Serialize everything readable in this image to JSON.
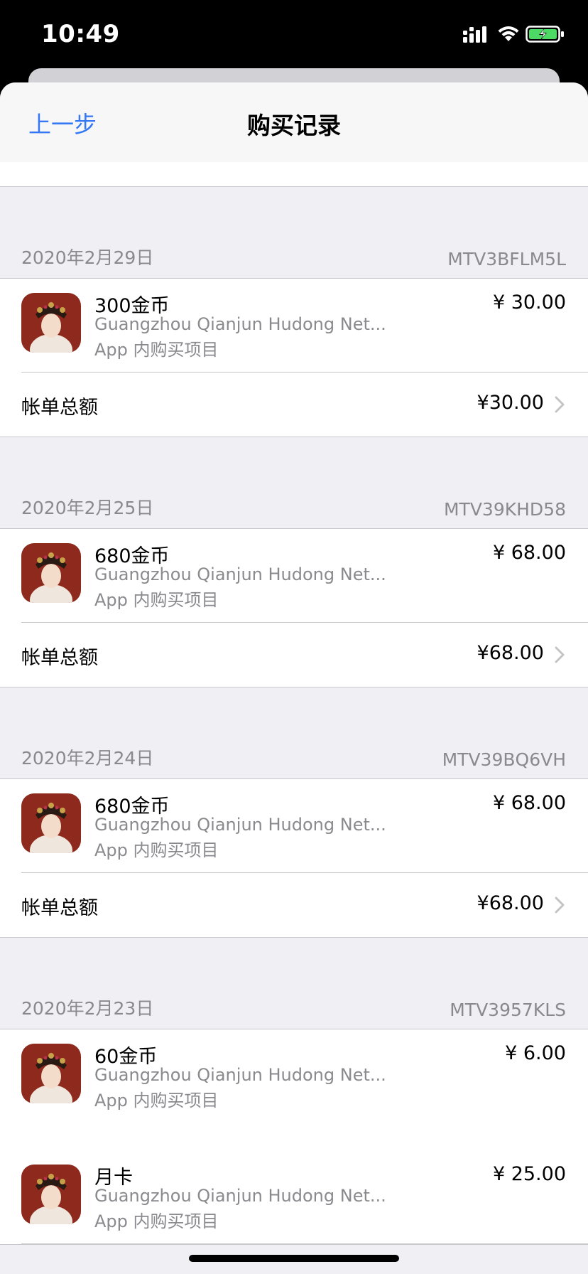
{
  "status_bar": {
    "time": "10:49"
  },
  "nav": {
    "back_label": "上一步",
    "title": "购买记录"
  },
  "groups": [
    {
      "date": "2020年2月29日",
      "order_id": "MTV3BFLM5L",
      "items": [
        {
          "name": "300金币",
          "developer": "Guangzhou Qianjun Hudong Net...",
          "type": "App 内购买项目",
          "price": "¥ 30.00"
        }
      ],
      "total_label": "帐单总额",
      "total_value": "¥30.00"
    },
    {
      "date": "2020年2月25日",
      "order_id": "MTV39KHD58",
      "items": [
        {
          "name": "680金币",
          "developer": "Guangzhou Qianjun Hudong Net...",
          "type": "App 内购买项目",
          "price": "¥ 68.00"
        }
      ],
      "total_label": "帐单总额",
      "total_value": "¥68.00"
    },
    {
      "date": "2020年2月24日",
      "order_id": "MTV39BQ6VH",
      "items": [
        {
          "name": "680金币",
          "developer": "Guangzhou Qianjun Hudong Net...",
          "type": "App 内购买项目",
          "price": "¥ 68.00"
        }
      ],
      "total_label": "帐单总额",
      "total_value": "¥68.00"
    },
    {
      "date": "2020年2月23日",
      "order_id": "MTV3957KLS",
      "items": [
        {
          "name": "60金币",
          "developer": "Guangzhou Qianjun Hudong Net...",
          "type": "App 内购买项目",
          "price": "¥ 6.00"
        },
        {
          "name": "月卡",
          "developer": "Guangzhou Qianjun Hudong Net...",
          "type": "App 内购买项目",
          "price": "¥ 25.00"
        }
      ]
    }
  ],
  "colors": {
    "accent": "#3478f6",
    "secondary_text": "#8a8a8e",
    "background": "#efeff4",
    "separator": "#c8c7cc"
  },
  "icons": {
    "app": "game-app-icon",
    "row_chevron": "chevron-right-icon"
  }
}
